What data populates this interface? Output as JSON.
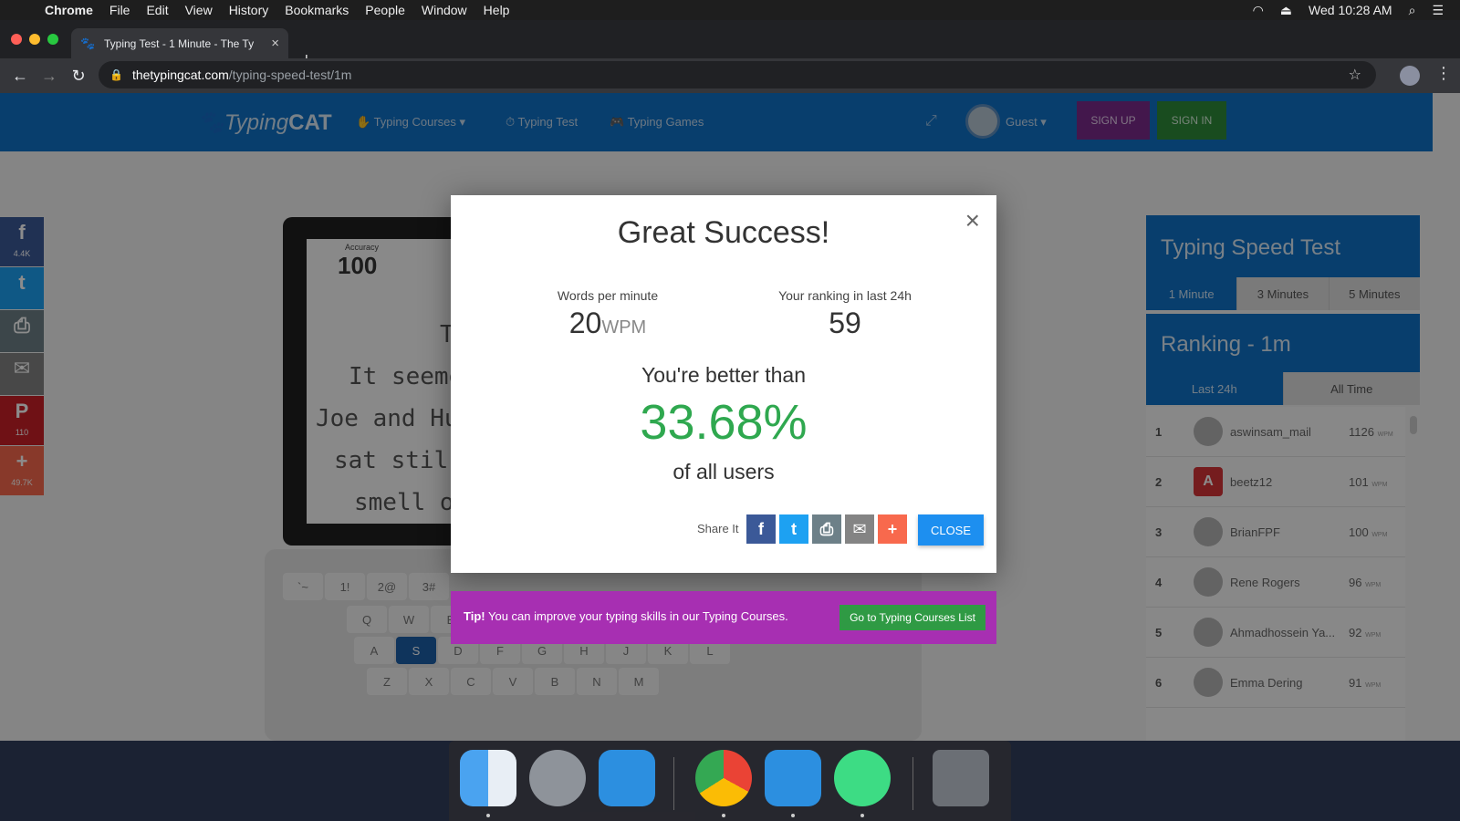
{
  "menubar": {
    "apple_icon": "apple-icon",
    "items": [
      "Chrome",
      "File",
      "Edit",
      "View",
      "History",
      "Bookmarks",
      "People",
      "Window",
      "Help"
    ],
    "clock": "Wed 10:28 AM"
  },
  "browser": {
    "tab_title": "Typing Test - 1 Minute - The Ty",
    "url_host": "thetypingcat.com",
    "url_path": "/typing-speed-test/1m"
  },
  "site": {
    "logo_a": "Typing",
    "logo_b": "CAT",
    "nav": [
      "Typing Courses",
      "Typing Test",
      "Typing Games"
    ],
    "guest": "Guest",
    "signup": "SIGN UP",
    "signin": "SIGN IN"
  },
  "social": [
    {
      "icon": "facebook-icon",
      "glyph": "f",
      "count": "4.4K",
      "color": "#3b5998"
    },
    {
      "icon": "twitter-icon",
      "glyph": "t",
      "count": "",
      "color": "#1da1f2"
    },
    {
      "icon": "print-icon",
      "glyph": "⎙",
      "count": "",
      "color": "#6d8088"
    },
    {
      "icon": "email-icon",
      "glyph": "✉",
      "count": "",
      "color": "#848484"
    },
    {
      "icon": "pinterest-icon",
      "glyph": "P",
      "count": "110",
      "color": "#cb2027"
    },
    {
      "icon": "addthis-plus-icon",
      "glyph": "+",
      "count": "49.7K",
      "color": "#f8694d"
    }
  ],
  "device": {
    "accuracy_label": "Accuracy",
    "accuracy_value": "100",
    "lines": [
      "T",
      "It seeme",
      "Joe and Hu",
      "sat stil",
      "smell o"
    ]
  },
  "keyboard": {
    "row1": [
      "`~",
      "1!",
      "2@",
      "3#"
    ],
    "row2": [
      "Q",
      "W",
      "E"
    ],
    "row3": [
      "A",
      "S",
      "D",
      "F",
      "G",
      "H",
      "J",
      "K",
      "L"
    ],
    "row4": [
      "Z",
      "X",
      "C",
      "V",
      "B",
      "N",
      "M"
    ]
  },
  "modal": {
    "title": "Great Success!",
    "wpm_label": "Words per minute",
    "wpm_value": "20",
    "wpm_unit": "WPM",
    "rank_label": "Your ranking in last 24h",
    "rank_value": "59",
    "better_than": "You're better than",
    "percent": "33.68%",
    "of_users": "of all users",
    "share_label": "Share It",
    "close_label": "CLOSE"
  },
  "tip": {
    "bold": "Tip!",
    "text": "You can improve your typing skills in our Typing Courses.",
    "button": "Go to Typing Courses List"
  },
  "speed_panel": {
    "title": "Typing Speed Test",
    "tabs": [
      "1 Minute",
      "3 Minutes",
      "5 Minutes"
    ]
  },
  "ranking_panel": {
    "title": "Ranking - 1m",
    "tabs": [
      "Last 24h",
      "All Time"
    ],
    "unit": "WPM",
    "rows": [
      {
        "rank": "1",
        "name": "aswinsam_mail",
        "wpm": "1126"
      },
      {
        "rank": "2",
        "name": "beetz12",
        "wpm": "101"
      },
      {
        "rank": "3",
        "name": "BrianFPF",
        "wpm": "100"
      },
      {
        "rank": "4",
        "name": "Rene Rogers",
        "wpm": "96"
      },
      {
        "rank": "5",
        "name": "Ahmadhossein Ya...",
        "wpm": "92"
      },
      {
        "rank": "6",
        "name": "Emma Dering",
        "wpm": "91"
      }
    ]
  },
  "dock": [
    "Finder",
    "Launchpad",
    "Simulator",
    "Chrome",
    "Xcode",
    "Android Studio",
    "Trash"
  ]
}
